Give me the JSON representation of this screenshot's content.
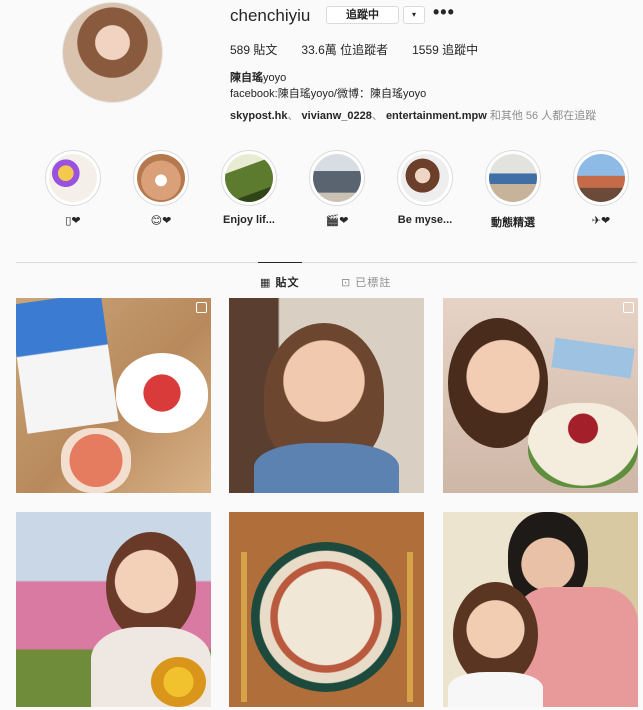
{
  "profile": {
    "username": "chenchiyiu",
    "following_label": "追蹤中",
    "dropdown_label": "▾",
    "more_label": "•••",
    "stats": {
      "posts_count": "589",
      "posts_label": "貼文",
      "followers_count": "33.6萬",
      "followers_label": "位追蹤者",
      "following_count": "1559",
      "following_label": "追蹤中"
    },
    "full_name": "陳自瑤",
    "full_name_sub": "yoyo",
    "bio": "facebook:陳自瑤yoyo/微博：陳自瑤yoyo",
    "followed_by": {
      "users": [
        "skypost.hk",
        "vivianw_0228",
        "entertainment.mpw"
      ],
      "separator": "、",
      "suffix_prefix": "和其他",
      "count": "56",
      "suffix": "人都在追蹤"
    }
  },
  "highlights": [
    {
      "label": "▯❤"
    },
    {
      "label": "😊❤"
    },
    {
      "label": "Enjoy lif..."
    },
    {
      "label": "🎬❤"
    },
    {
      "label": "Be myse..."
    },
    {
      "label": "動態精選"
    },
    {
      "label": "✈❤"
    }
  ],
  "tabs": {
    "posts_label": "貼文",
    "posts_icon": "grid-icon",
    "tagged_label": "已標註",
    "tagged_icon": "tag-icon"
  },
  "colors": {
    "text": "#262626",
    "secondary": "#8e8e8e",
    "border": "#dbdbdb",
    "background": "#fafafa"
  }
}
